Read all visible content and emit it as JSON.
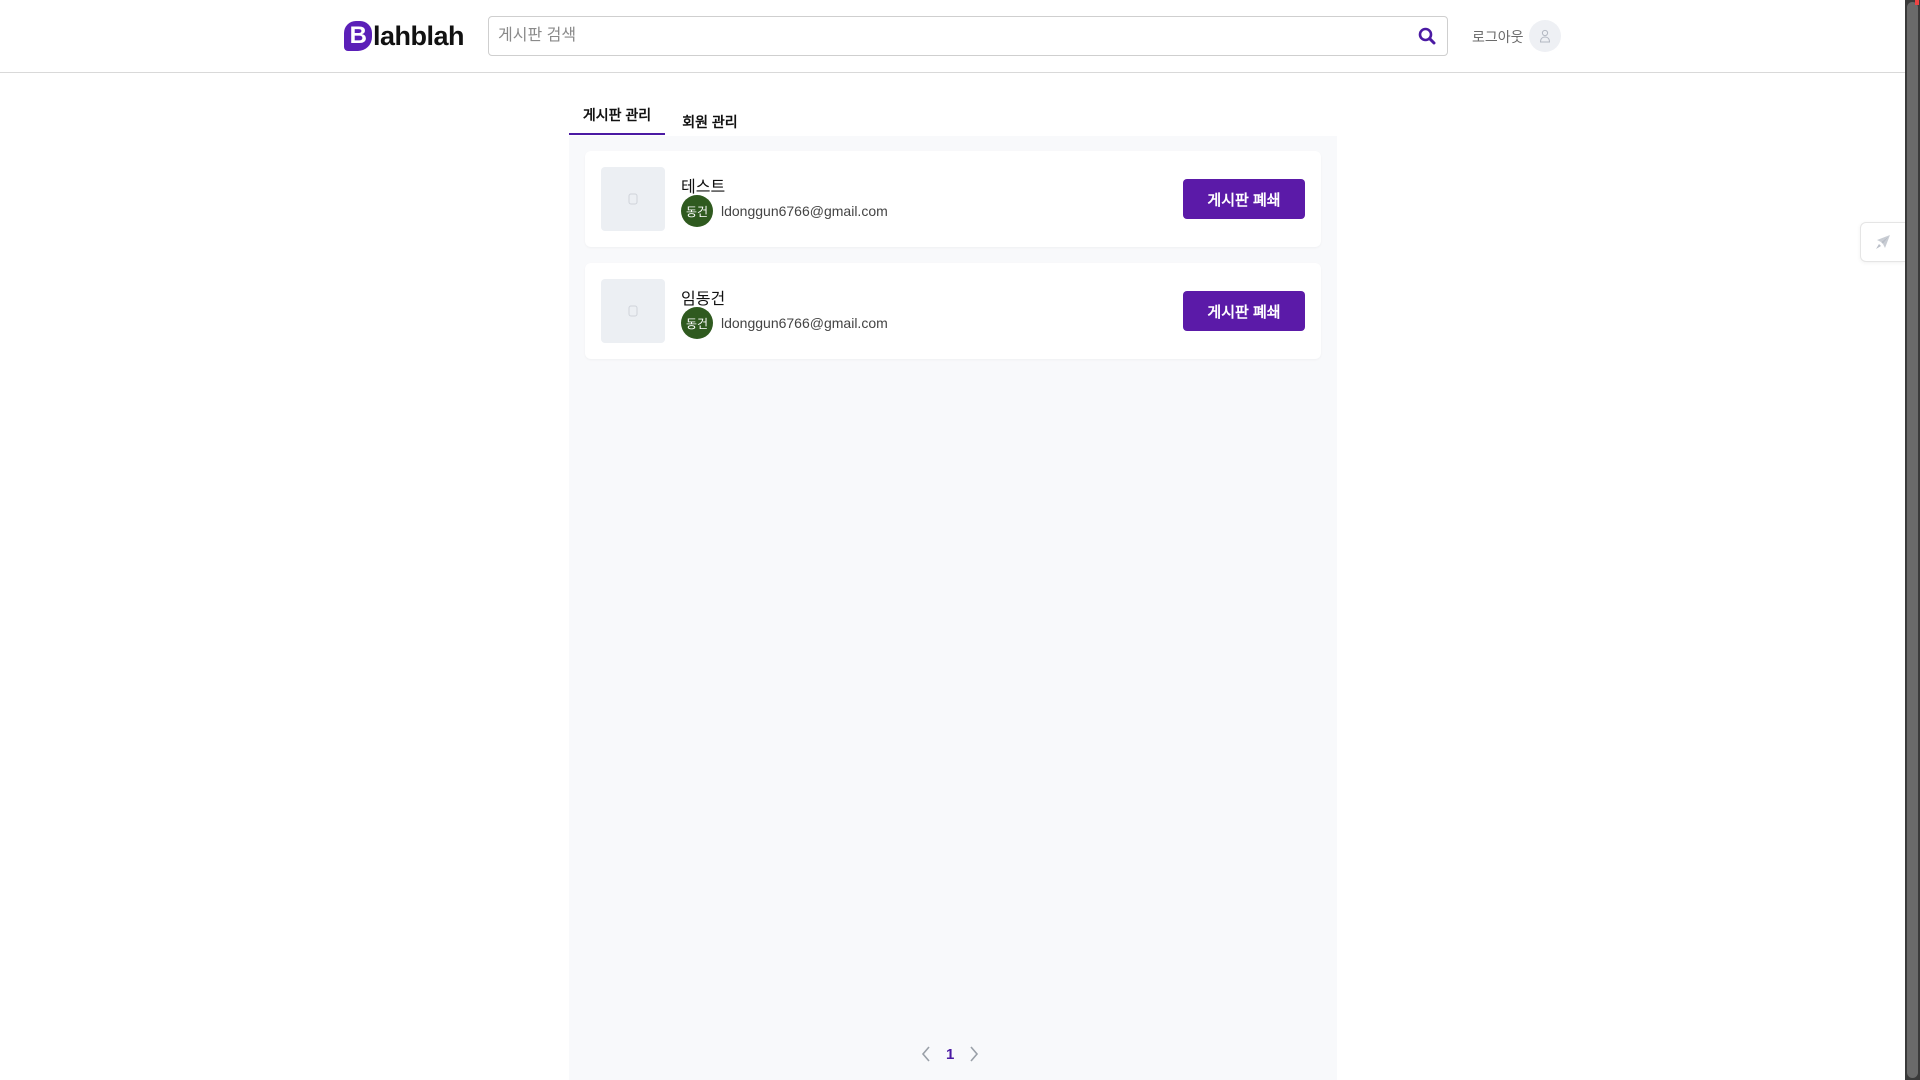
{
  "header": {
    "logo_letter": "B",
    "logo_rest": "lahblah",
    "search_placeholder": "게시판 검색",
    "logout_label": "로그아웃"
  },
  "tabs": [
    {
      "label": "게시판 관리",
      "active": true
    },
    {
      "label": "회원 관리",
      "active": false
    }
  ],
  "boards": [
    {
      "title": "테스트",
      "owner_avatar": "동건",
      "owner_email": "ldonggun6766@gmail.com",
      "action_label": "게시판 폐쇄"
    },
    {
      "title": "임동건",
      "owner_avatar": "동건",
      "owner_email": "ldonggun6766@gmail.com",
      "action_label": "게시판 폐쇄"
    }
  ],
  "pagination": {
    "current_page": "1"
  },
  "colors": {
    "accent": "#5b1aa8",
    "owner_avatar_bg": "#2f5a1f",
    "panel_bg": "#f8f9fb"
  },
  "icons": {
    "search": "search-icon",
    "user": "user-icon",
    "rocket": "rocket-icon",
    "prev": "chevron-left-icon",
    "next": "chevron-right-icon"
  }
}
